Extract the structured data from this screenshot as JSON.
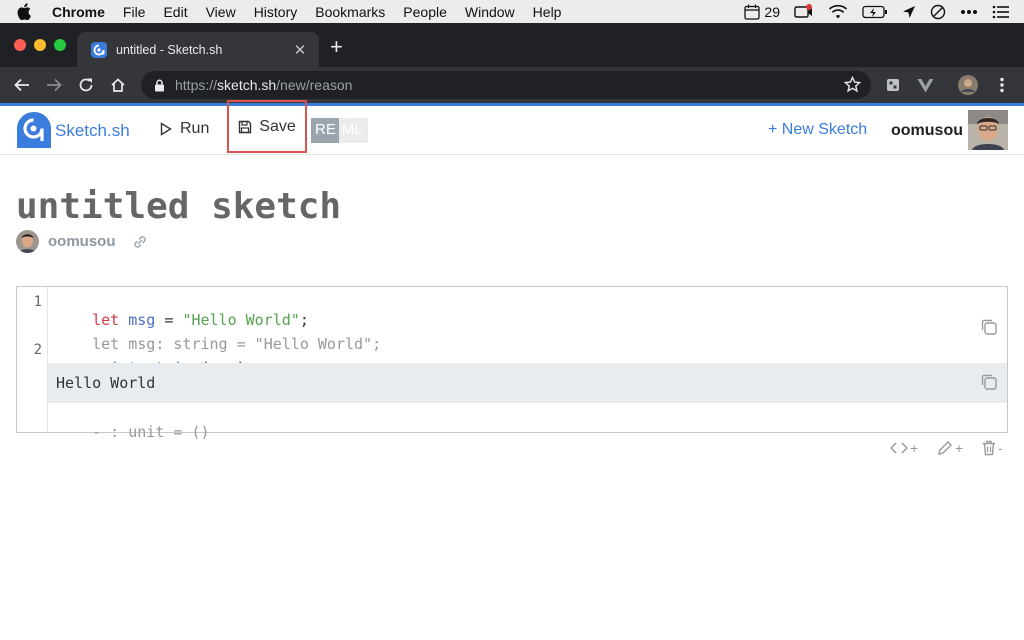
{
  "menubar": {
    "app": "Chrome",
    "items": [
      "File",
      "Edit",
      "View",
      "History",
      "Bookmarks",
      "People",
      "Window",
      "Help"
    ],
    "calendar_day": "29"
  },
  "browser": {
    "tab_title": "untitled - Sketch.sh",
    "url_prefix": "https://",
    "url_host": "sketch.sh",
    "url_path": "/new/reason"
  },
  "app": {
    "brand": "Sketch.sh",
    "run_label": "Run",
    "save_label": "Save",
    "lang_re": "RE",
    "lang_ml": "ML",
    "new_sketch_label": "+ New Sketch",
    "username": "oomusou"
  },
  "sketch": {
    "title": "untitled sketch",
    "author": "oomusou",
    "lines": [
      {
        "num": "1",
        "tokens": [
          [
            "let",
            "kw"
          ],
          [
            " ",
            "pun"
          ],
          [
            "msg",
            "id"
          ],
          [
            " = ",
            "pun"
          ],
          [
            "\"Hello World\"",
            "str"
          ],
          [
            ";",
            "pun"
          ]
        ]
      },
      {
        "num": "",
        "tokens": [
          [
            "let msg: string = \"Hello World\";",
            "hint"
          ]
        ]
      },
      {
        "num": "2",
        "tokens": [
          [
            "print_string",
            "id"
          ],
          [
            "(",
            "pun"
          ],
          [
            "msg",
            "id"
          ],
          [
            ");",
            "pun"
          ]
        ]
      }
    ],
    "output": "Hello World",
    "result_hint": "- : unit = ()"
  },
  "block_actions": {
    "code_plus": "+",
    "text_plus": "+",
    "delete_minus": "-"
  }
}
